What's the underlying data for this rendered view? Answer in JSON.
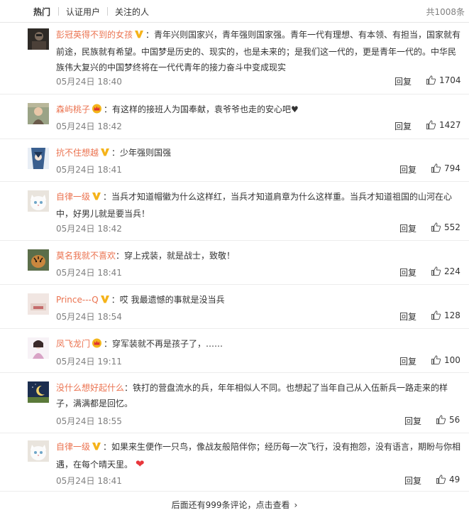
{
  "tabs": {
    "hot": "热门",
    "verified": "认证用户",
    "following": "关注的人",
    "total": "共1008条"
  },
  "reply_label": "回复",
  "comments": [
    {
      "user": "彭冠英得不到的女孩",
      "badge": "v-gold",
      "text": "：青年兴则国家兴，青年强则国家强。青年一代有理想、有本领、有担当，国家就有前途，民族就有希望。中国梦是历史的、现实的，也是未来的；是我们这一代的，更是青年一代的。中华民族伟大复兴的中国梦终将在一代代青年的接力奋斗中变成现实",
      "time": "05月24日 18:40",
      "likes": "1704",
      "avatar": "dark-portrait"
    },
    {
      "user": "森屿桃子",
      "badge": "crown-red",
      "text": "：有这样的接班人为国奉献，袁爷爷也走的安心吧♥",
      "time": "05月24日 18:42",
      "likes": "1427",
      "avatar": "girl-photo"
    },
    {
      "user": "抗不住想越",
      "badge": "v-gold",
      "text": "：少年强则国强",
      "time": "05月24日 18:41",
      "likes": "794",
      "avatar": "anime-blue"
    },
    {
      "user": "自律一级",
      "badge": "v-gold",
      "text": "：当兵才知道帽徽为什么这样红，当兵才知道肩章为什么这样重。当兵才知道祖国的山河在心中，好男儿就是要当兵！",
      "time": "05月24日 18:42",
      "likes": "552",
      "avatar": "white-cat"
    },
    {
      "user": "莫名我就不喜欢",
      "badge": "none",
      "text": "：穿上戎装，就是战士，致敬！",
      "time": "05月24日 18:41",
      "likes": "224",
      "avatar": "tiger"
    },
    {
      "user": "Prince---Q",
      "badge": "v-gold",
      "text": "：哎 我最遗憾的事就是没当兵",
      "time": "05月24日 18:54",
      "likes": "128",
      "avatar": "light-photo"
    },
    {
      "user": "凤飞龙门",
      "badge": "crown-red",
      "text": "：穿军装就不再是孩子了，……",
      "time": "05月24日 19:11",
      "likes": "100",
      "avatar": "girl-pink"
    },
    {
      "user": "没什么想好起什么",
      "badge": "none",
      "text": "：铁打的营盘流水的兵，年年相似人不同。也想起了当年自己从入伍新兵一路走来的样子，满满都是回忆。",
      "time": "05月24日 18:55",
      "likes": "56",
      "avatar": "night-sky"
    },
    {
      "user": "自律一级",
      "badge": "v-gold",
      "text": "：如果来生便作一只鸟，像战友般陪伴你；经历每一次飞行，没有抱怨，没有语言，期盼与你相遇，在每个晴天里。",
      "heart": "❤",
      "time": "05月24日 18:41",
      "likes": "49",
      "avatar": "white-cat"
    }
  ],
  "footer": {
    "more": "后面还有999条评论，点击查看"
  },
  "colors": {
    "username": "#eb7350",
    "meta": "#808080",
    "badge_gold": "#f5b31a",
    "heart": "#e8363b"
  }
}
